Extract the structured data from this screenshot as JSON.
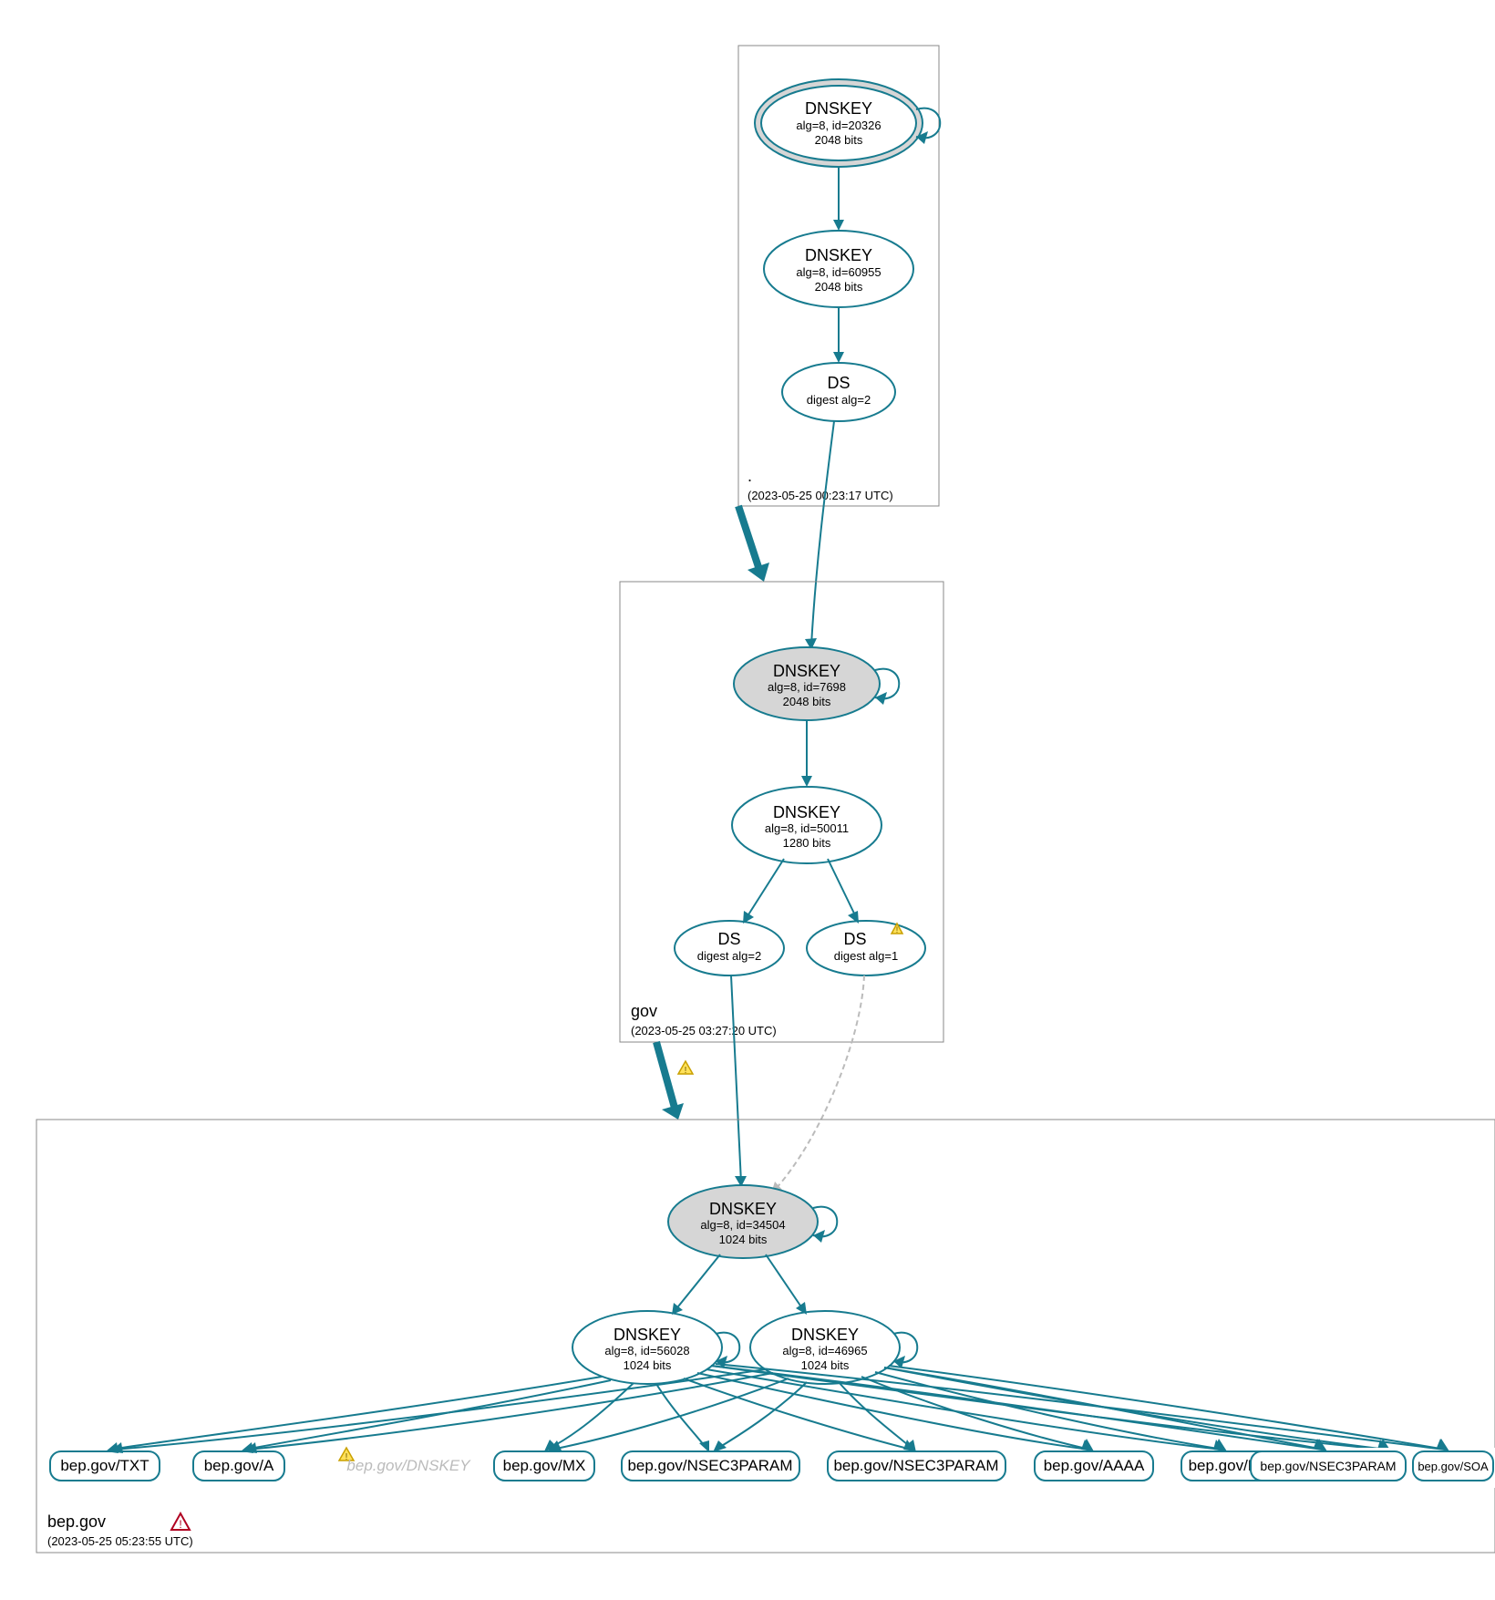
{
  "zones": {
    "root": {
      "label": ".",
      "time": "(2023-05-25 00:23:17 UTC)"
    },
    "gov": {
      "label": "gov",
      "time": "(2023-05-25 03:27:20 UTC)"
    },
    "bep": {
      "label": "bep.gov",
      "time": "(2023-05-25 05:23:55 UTC)"
    }
  },
  "nodes": {
    "root_ksk": {
      "title": "DNSKEY",
      "sub1": "alg=8, id=20326",
      "sub2": "2048 bits"
    },
    "root_zsk": {
      "title": "DNSKEY",
      "sub1": "alg=8, id=60955",
      "sub2": "2048 bits"
    },
    "root_ds": {
      "title": "DS",
      "sub1": "digest alg=2",
      "sub2": ""
    },
    "gov_ksk": {
      "title": "DNSKEY",
      "sub1": "alg=8, id=7698",
      "sub2": "2048 bits"
    },
    "gov_zsk": {
      "title": "DNSKEY",
      "sub1": "alg=8, id=50011",
      "sub2": "1280 bits"
    },
    "gov_ds1": {
      "title": "DS",
      "sub1": "digest alg=2",
      "sub2": ""
    },
    "gov_ds2": {
      "title": "DS",
      "sub1": "digest alg=1",
      "sub2": ""
    },
    "bep_ksk": {
      "title": "DNSKEY",
      "sub1": "alg=8, id=34504",
      "sub2": "1024 bits"
    },
    "bep_zsk1": {
      "title": "DNSKEY",
      "sub1": "alg=8, id=56028",
      "sub2": "1024 bits"
    },
    "bep_zsk2": {
      "title": "DNSKEY",
      "sub1": "alg=8, id=46965",
      "sub2": "1024 bits"
    }
  },
  "rr": {
    "txt": "bep.gov/TXT",
    "a": "bep.gov/A",
    "dnskey": "bep.gov/DNSKEY",
    "mx": "bep.gov/MX",
    "n3a": "bep.gov/NSEC3PARAM",
    "n3b": "bep.gov/NSEC3PARAM",
    "aaaa": "bep.gov/AAAA",
    "ns": "bep.gov/NS",
    "n3c": "bep.gov/NSEC3PARAM",
    "soa": "bep.gov/SOA"
  }
}
